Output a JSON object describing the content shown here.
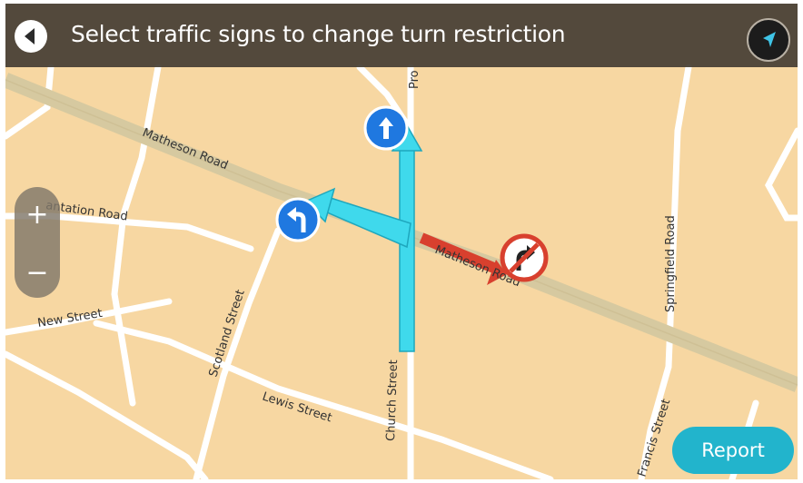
{
  "header": {
    "title": "Select traffic signs to change turn restriction",
    "back_icon": "chevron-left-icon",
    "compass_icon": "navigation-arrow-icon"
  },
  "map": {
    "streets": {
      "matheson_road_west": "Matheson Road",
      "matheson_road_east": "Matheson Road",
      "plantation_road": "antation Road",
      "scotland_street": "Scotland Street",
      "new_street": "New Street",
      "lewis_street": "Lewis Street",
      "church_street": "Church Street",
      "springfield_road": "Springfield Road",
      "francis_street": "Francis Street",
      "top_road": "Pro"
    },
    "signs": {
      "straight": "straight-arrow-icon",
      "left_turn": "left-turn-arrow-icon",
      "no_right_turn": "no-right-turn-icon"
    },
    "colors": {
      "map_background": "#f7d7a2",
      "route_highlight": "#3fd9ec",
      "restricted_route": "#d8402e",
      "sign_blue": "#1f78e0",
      "accent": "#22b4cc"
    }
  },
  "zoom": {
    "in_label": "+",
    "out_label": "−"
  },
  "actions": {
    "report_label": "Report"
  }
}
